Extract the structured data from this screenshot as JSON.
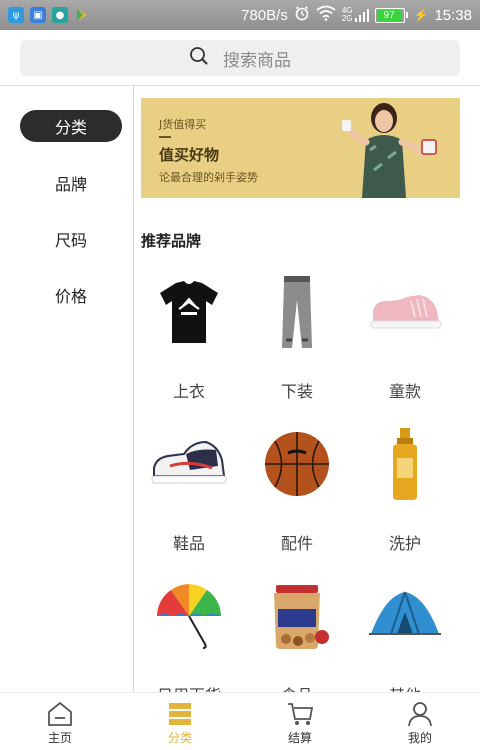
{
  "status_bar": {
    "network_speed": "780B/s",
    "signal_top": "4G",
    "signal_bottom": "2G",
    "battery": "97",
    "time": "15:38"
  },
  "search": {
    "placeholder": "搜索商品"
  },
  "sidebar": {
    "items": [
      {
        "label": "分类",
        "active": true
      },
      {
        "label": "品牌",
        "active": false
      },
      {
        "label": "尺码",
        "active": false
      },
      {
        "label": "价格",
        "active": false
      }
    ]
  },
  "banner": {
    "subtitle": "J货值得买",
    "title": "值买好物",
    "slogan": "论最合理的剁手姿势"
  },
  "section": {
    "title": "推荐品牌"
  },
  "categories": [
    {
      "label": "上衣",
      "icon": "tshirt-icon"
    },
    {
      "label": "下装",
      "icon": "pants-icon"
    },
    {
      "label": "童款",
      "icon": "kids-shoe-icon"
    },
    {
      "label": "鞋品",
      "icon": "sneaker-icon"
    },
    {
      "label": "配件",
      "icon": "basketball-icon"
    },
    {
      "label": "洗护",
      "icon": "shampoo-bottle-icon"
    },
    {
      "label": "日用百货",
      "icon": "umbrella-icon"
    },
    {
      "label": "食品",
      "icon": "nuts-jar-icon"
    },
    {
      "label": "其他",
      "icon": "tent-icon"
    }
  ],
  "bottom_nav": {
    "items": [
      {
        "label": "主页",
        "icon": "home-icon",
        "active": false
      },
      {
        "label": "分类",
        "icon": "category-icon",
        "active": true
      },
      {
        "label": "结算",
        "icon": "cart-icon",
        "active": false
      },
      {
        "label": "我的",
        "icon": "profile-icon",
        "active": false
      }
    ]
  },
  "colors": {
    "accent": "#e3b43c",
    "active_pill": "#2c2c2c",
    "banner_bg": "#e8cf83"
  }
}
